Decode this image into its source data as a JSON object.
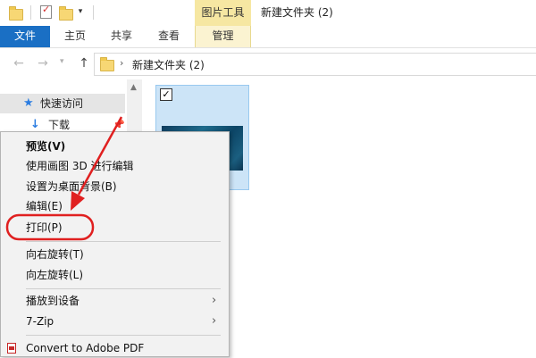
{
  "window": {
    "title": "新建文件夹 (2)",
    "contextual_tab_group": "图片工具"
  },
  "ribbon": {
    "tabs": [
      {
        "label": "文件"
      },
      {
        "label": "主页"
      },
      {
        "label": "共享"
      },
      {
        "label": "查看"
      },
      {
        "label": "管理"
      }
    ]
  },
  "address": {
    "path": "新建文件夹 (2)"
  },
  "navpane": {
    "quick_access": "快速访问",
    "downloads": "下载"
  },
  "content": {
    "selected_item_checked": true
  },
  "context_menu": {
    "items": [
      {
        "label": "预览(V)"
      },
      {
        "label": "使用画图 3D 进行编辑"
      },
      {
        "label": "设置为桌面背景(B)"
      },
      {
        "label": "编辑(E)"
      },
      {
        "label": "打印(P)"
      },
      {
        "label": "向右旋转(T)"
      },
      {
        "label": "向左旋转(L)"
      },
      {
        "label": "播放到设备"
      },
      {
        "label": "7-Zip"
      },
      {
        "label": "Convert to Adobe PDF"
      }
    ]
  },
  "annotation": {
    "color": "#e02020",
    "highlighted_item": "打印(P)"
  },
  "colors": {
    "file_tab": "#1a6fc4",
    "contextual_tab": "#f6e7a2",
    "selection": "#cce4f7"
  },
  "icons": [
    "folder-icon",
    "properties-icon",
    "back-arrow-icon",
    "forward-arrow-icon",
    "up-arrow-icon",
    "star-icon",
    "download-icon",
    "pin-icon",
    "pdf-icon",
    "chevron-right-icon"
  ]
}
